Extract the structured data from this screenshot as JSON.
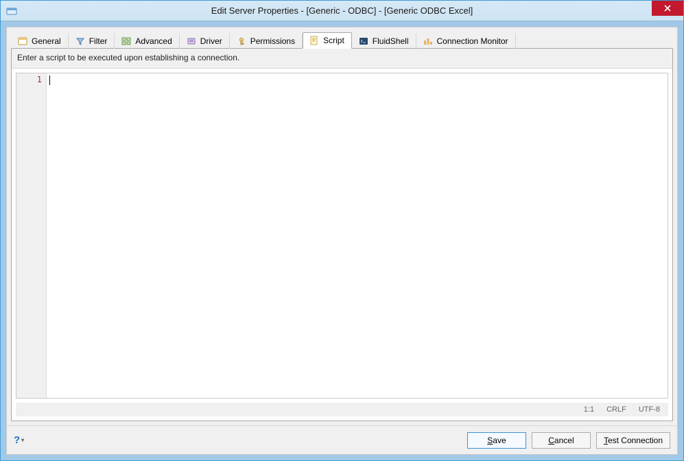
{
  "titlebar": {
    "title": "Edit Server Properties - [Generic - ODBC] - [Generic ODBC Excel]"
  },
  "tabs": [
    {
      "label": "General",
      "icon": "general-icon"
    },
    {
      "label": "Filter",
      "icon": "filter-icon"
    },
    {
      "label": "Advanced",
      "icon": "advanced-icon"
    },
    {
      "label": "Driver",
      "icon": "driver-icon"
    },
    {
      "label": "Permissions",
      "icon": "permissions-icon"
    },
    {
      "label": "Script",
      "icon": "script-icon",
      "active": true
    },
    {
      "label": "FluidShell",
      "icon": "fluidshell-icon"
    },
    {
      "label": "Connection Monitor",
      "icon": "monitor-icon"
    }
  ],
  "script_panel": {
    "instruction": "Enter a script to be executed upon establishing a connection.",
    "gutter_line": "1",
    "content": ""
  },
  "status": {
    "position": "1:1",
    "lineend": "CRLF",
    "encoding": "UTF-8"
  },
  "buttons": {
    "help": "?",
    "save": "Save",
    "cancel": "Cancel",
    "test": "Test Connection"
  }
}
